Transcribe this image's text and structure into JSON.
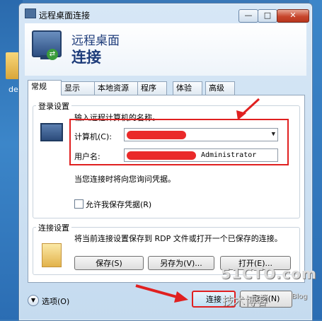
{
  "desktop": {
    "icon_label": "de"
  },
  "window": {
    "title": "远程桌面连接",
    "min_label": "—",
    "max_label": "□",
    "close_label": "✕"
  },
  "header": {
    "subtitle": "远程桌面",
    "title": "连接"
  },
  "tabs": [
    {
      "label": "常规",
      "active": true
    },
    {
      "label": "显示",
      "active": false
    },
    {
      "label": "本地资源",
      "active": false
    },
    {
      "label": "程序",
      "active": false
    },
    {
      "label": "体验",
      "active": false
    },
    {
      "label": "高级",
      "active": false
    }
  ],
  "login": {
    "group_title": "登录设置",
    "prompt": "输入远程计算机的名称。",
    "computer_label": "计算机(C):",
    "computer_value": "",
    "username_label": "用户名:",
    "username_value": "Administrator",
    "credential_note": "当您连接时将向您询问凭据。",
    "save_checkbox_label": "允许我保存凭据(R)",
    "save_checked": false
  },
  "connection": {
    "group_title": "连接设置",
    "description": "将当前连接设置保存到 RDP 文件或打开一个已保存的连接。",
    "save_label": "保存(S)",
    "save_as_label": "另存为(V)...",
    "open_label": "打开(E)..."
  },
  "footer": {
    "options_label": "选项(O)",
    "connect_label": "连接",
    "cancel_label": "取消(N)"
  },
  "watermark": {
    "line1": "51CTO.com",
    "line2": "技术博客",
    "line3": "Blog"
  },
  "colors": {
    "annotation_red": "#e02020",
    "header_text": "#1e3c7a"
  }
}
